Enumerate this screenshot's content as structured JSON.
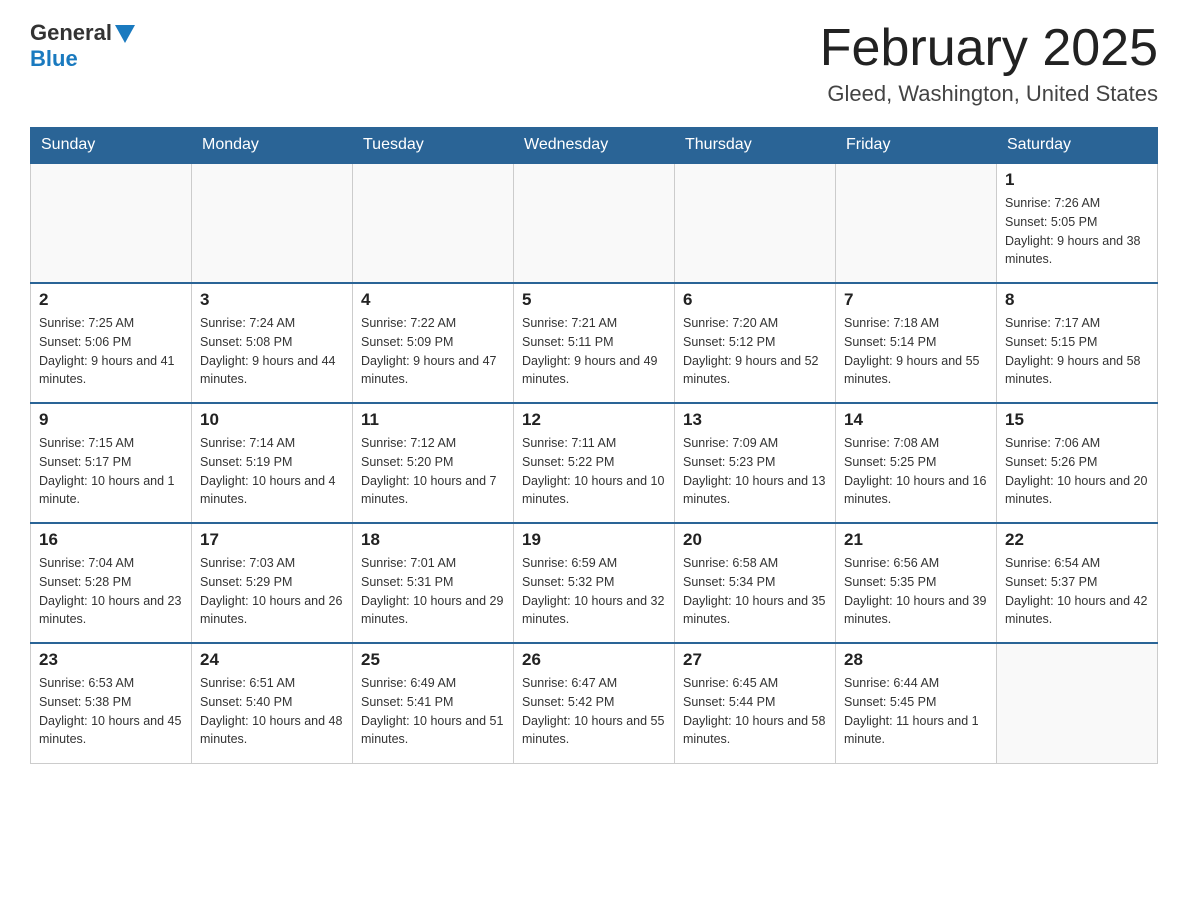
{
  "header": {
    "logo_general": "General",
    "logo_blue": "Blue",
    "month_title": "February 2025",
    "location": "Gleed, Washington, United States"
  },
  "days_of_week": [
    "Sunday",
    "Monday",
    "Tuesday",
    "Wednesday",
    "Thursday",
    "Friday",
    "Saturday"
  ],
  "weeks": [
    [
      {
        "day": "",
        "info": ""
      },
      {
        "day": "",
        "info": ""
      },
      {
        "day": "",
        "info": ""
      },
      {
        "day": "",
        "info": ""
      },
      {
        "day": "",
        "info": ""
      },
      {
        "day": "",
        "info": ""
      },
      {
        "day": "1",
        "info": "Sunrise: 7:26 AM\nSunset: 5:05 PM\nDaylight: 9 hours and 38 minutes."
      }
    ],
    [
      {
        "day": "2",
        "info": "Sunrise: 7:25 AM\nSunset: 5:06 PM\nDaylight: 9 hours and 41 minutes."
      },
      {
        "day": "3",
        "info": "Sunrise: 7:24 AM\nSunset: 5:08 PM\nDaylight: 9 hours and 44 minutes."
      },
      {
        "day": "4",
        "info": "Sunrise: 7:22 AM\nSunset: 5:09 PM\nDaylight: 9 hours and 47 minutes."
      },
      {
        "day": "5",
        "info": "Sunrise: 7:21 AM\nSunset: 5:11 PM\nDaylight: 9 hours and 49 minutes."
      },
      {
        "day": "6",
        "info": "Sunrise: 7:20 AM\nSunset: 5:12 PM\nDaylight: 9 hours and 52 minutes."
      },
      {
        "day": "7",
        "info": "Sunrise: 7:18 AM\nSunset: 5:14 PM\nDaylight: 9 hours and 55 minutes."
      },
      {
        "day": "8",
        "info": "Sunrise: 7:17 AM\nSunset: 5:15 PM\nDaylight: 9 hours and 58 minutes."
      }
    ],
    [
      {
        "day": "9",
        "info": "Sunrise: 7:15 AM\nSunset: 5:17 PM\nDaylight: 10 hours and 1 minute."
      },
      {
        "day": "10",
        "info": "Sunrise: 7:14 AM\nSunset: 5:19 PM\nDaylight: 10 hours and 4 minutes."
      },
      {
        "day": "11",
        "info": "Sunrise: 7:12 AM\nSunset: 5:20 PM\nDaylight: 10 hours and 7 minutes."
      },
      {
        "day": "12",
        "info": "Sunrise: 7:11 AM\nSunset: 5:22 PM\nDaylight: 10 hours and 10 minutes."
      },
      {
        "day": "13",
        "info": "Sunrise: 7:09 AM\nSunset: 5:23 PM\nDaylight: 10 hours and 13 minutes."
      },
      {
        "day": "14",
        "info": "Sunrise: 7:08 AM\nSunset: 5:25 PM\nDaylight: 10 hours and 16 minutes."
      },
      {
        "day": "15",
        "info": "Sunrise: 7:06 AM\nSunset: 5:26 PM\nDaylight: 10 hours and 20 minutes."
      }
    ],
    [
      {
        "day": "16",
        "info": "Sunrise: 7:04 AM\nSunset: 5:28 PM\nDaylight: 10 hours and 23 minutes."
      },
      {
        "day": "17",
        "info": "Sunrise: 7:03 AM\nSunset: 5:29 PM\nDaylight: 10 hours and 26 minutes."
      },
      {
        "day": "18",
        "info": "Sunrise: 7:01 AM\nSunset: 5:31 PM\nDaylight: 10 hours and 29 minutes."
      },
      {
        "day": "19",
        "info": "Sunrise: 6:59 AM\nSunset: 5:32 PM\nDaylight: 10 hours and 32 minutes."
      },
      {
        "day": "20",
        "info": "Sunrise: 6:58 AM\nSunset: 5:34 PM\nDaylight: 10 hours and 35 minutes."
      },
      {
        "day": "21",
        "info": "Sunrise: 6:56 AM\nSunset: 5:35 PM\nDaylight: 10 hours and 39 minutes."
      },
      {
        "day": "22",
        "info": "Sunrise: 6:54 AM\nSunset: 5:37 PM\nDaylight: 10 hours and 42 minutes."
      }
    ],
    [
      {
        "day": "23",
        "info": "Sunrise: 6:53 AM\nSunset: 5:38 PM\nDaylight: 10 hours and 45 minutes."
      },
      {
        "day": "24",
        "info": "Sunrise: 6:51 AM\nSunset: 5:40 PM\nDaylight: 10 hours and 48 minutes."
      },
      {
        "day": "25",
        "info": "Sunrise: 6:49 AM\nSunset: 5:41 PM\nDaylight: 10 hours and 51 minutes."
      },
      {
        "day": "26",
        "info": "Sunrise: 6:47 AM\nSunset: 5:42 PM\nDaylight: 10 hours and 55 minutes."
      },
      {
        "day": "27",
        "info": "Sunrise: 6:45 AM\nSunset: 5:44 PM\nDaylight: 10 hours and 58 minutes."
      },
      {
        "day": "28",
        "info": "Sunrise: 6:44 AM\nSunset: 5:45 PM\nDaylight: 11 hours and 1 minute."
      },
      {
        "day": "",
        "info": ""
      }
    ]
  ]
}
